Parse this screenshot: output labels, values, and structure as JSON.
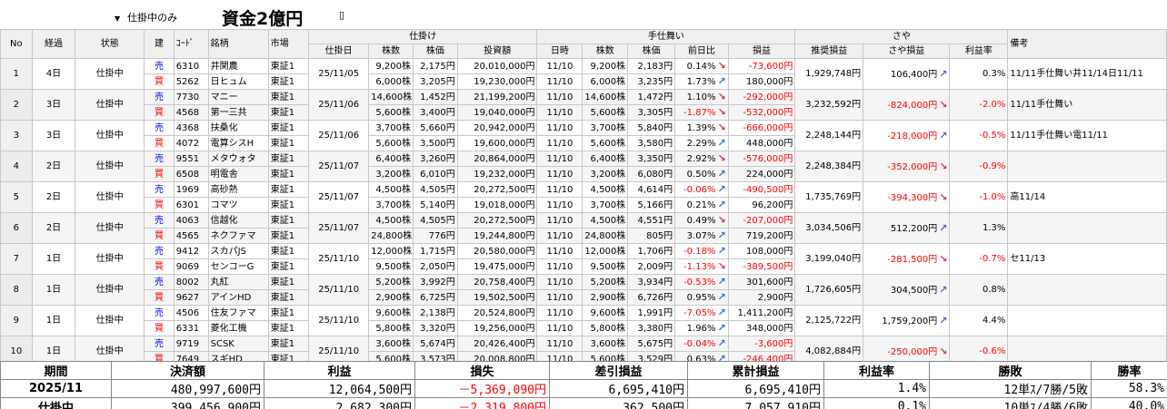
{
  "top": {
    "filter": "仕掛中のみ",
    "capital": "資金2億円",
    "tick": "▯"
  },
  "headers": {
    "no": "No",
    "elapsed": "経過",
    "state": "状態",
    "side": "建",
    "code": "ｺｰﾄﾞ",
    "name": "銘柄",
    "market": "市場",
    "open_group": "仕掛け",
    "open_date": "仕掛日",
    "shares": "株数",
    "price": "株価",
    "invest": "投資額",
    "close_group": "手仕舞い",
    "time": "日時",
    "c_shares": "株数",
    "c_price": "株価",
    "prev": "前日比",
    "pl": "損益",
    "spread_group": "さや",
    "rec_pl": "推奨損益",
    "spread_pl": "さや損益",
    "rate": "利益率",
    "note": "備考"
  },
  "rows": [
    {
      "no": "1",
      "elapsed": "4日",
      "state": "仕掛中",
      "date": "25/11/05",
      "close_date": "11/10",
      "rec": "1,929,748円",
      "spread": "106,400円",
      "spread_dir": "up",
      "rate": "0.3%",
      "rate_neg": false,
      "note": "11/11手仕舞い井11/14日11/11",
      "legs": [
        {
          "side": "売",
          "code": "6310",
          "name": "井関農",
          "market": "東証1",
          "shares": "9,200株",
          "price": "2,175円",
          "invest": "20,010,000円",
          "c_shares": "9,200株",
          "c_price": "2,183円",
          "prev": "0.14%",
          "prev_neg": false,
          "dir": "dn",
          "pl": "-73,600円",
          "pl_neg": true
        },
        {
          "side": "買",
          "code": "5262",
          "name": "日ヒュム",
          "market": "東証1",
          "shares": "6,000株",
          "price": "3,205円",
          "invest": "19,230,000円",
          "c_shares": "6,000株",
          "c_price": "3,235円",
          "prev": "1.73%",
          "prev_neg": false,
          "dir": "up",
          "pl": "180,000円",
          "pl_neg": false
        }
      ]
    },
    {
      "no": "2",
      "elapsed": "3日",
      "state": "仕掛中",
      "date": "25/11/06",
      "close_date": "11/10",
      "rec": "3,232,592円",
      "spread": "-824,000円",
      "spread_dir": "dn",
      "rate": "-2.0%",
      "rate_neg": true,
      "note": "11/11手仕舞い",
      "legs": [
        {
          "side": "売",
          "code": "7730",
          "name": "マニー",
          "market": "東証1",
          "shares": "14,600株",
          "price": "1,452円",
          "invest": "21,199,200円",
          "c_shares": "14,600株",
          "c_price": "1,472円",
          "prev": "1.10%",
          "prev_neg": false,
          "dir": "dn",
          "pl": "-292,000円",
          "pl_neg": true
        },
        {
          "side": "買",
          "code": "4568",
          "name": "第一三共",
          "market": "東証1",
          "shares": "5,600株",
          "price": "3,400円",
          "invest": "19,040,000円",
          "c_shares": "5,600株",
          "c_price": "3,305円",
          "prev": "-1.87%",
          "prev_neg": true,
          "dir": "dn",
          "pl": "-532,000円",
          "pl_neg": true
        }
      ]
    },
    {
      "no": "3",
      "elapsed": "3日",
      "state": "仕掛中",
      "date": "25/11/06",
      "close_date": "11/10",
      "rec": "2,248,144円",
      "spread": "-218,000円",
      "spread_dir": "up",
      "rate": "-0.5%",
      "rate_neg": true,
      "note": "11/11手仕舞い電11/11",
      "legs": [
        {
          "side": "売",
          "code": "4368",
          "name": "扶桑化",
          "market": "東証1",
          "shares": "3,700株",
          "price": "5,660円",
          "invest": "20,942,000円",
          "c_shares": "3,700株",
          "c_price": "5,840円",
          "prev": "1.39%",
          "prev_neg": false,
          "dir": "dn",
          "pl": "-666,000円",
          "pl_neg": true
        },
        {
          "side": "買",
          "code": "4072",
          "name": "電算シスH",
          "market": "東証1",
          "shares": "5,600株",
          "price": "3,500円",
          "invest": "19,600,000円",
          "c_shares": "5,600株",
          "c_price": "3,580円",
          "prev": "2.29%",
          "prev_neg": false,
          "dir": "up",
          "pl": "448,000円",
          "pl_neg": false
        }
      ]
    },
    {
      "no": "4",
      "elapsed": "2日",
      "state": "仕掛中",
      "date": "25/11/07",
      "close_date": "11/10",
      "rec": "2,248,384円",
      "spread": "-352,000円",
      "spread_dir": "dn",
      "rate": "-0.9%",
      "rate_neg": true,
      "note": "",
      "legs": [
        {
          "side": "売",
          "code": "9551",
          "name": "メタウォタ",
          "market": "東証1",
          "shares": "6,400株",
          "price": "3,260円",
          "invest": "20,864,000円",
          "c_shares": "6,400株",
          "c_price": "3,350円",
          "prev": "2.92%",
          "prev_neg": false,
          "dir": "dn",
          "pl": "-576,000円",
          "pl_neg": true
        },
        {
          "side": "買",
          "code": "6508",
          "name": "明電舎",
          "market": "東証1",
          "shares": "3,200株",
          "price": "6,010円",
          "invest": "19,232,000円",
          "c_shares": "3,200株",
          "c_price": "6,080円",
          "prev": "0.50%",
          "prev_neg": false,
          "dir": "up",
          "pl": "224,000円",
          "pl_neg": false
        }
      ]
    },
    {
      "no": "5",
      "elapsed": "2日",
      "state": "仕掛中",
      "date": "25/11/07",
      "close_date": "11/10",
      "rec": "1,735,769円",
      "spread": "-394,300円",
      "spread_dir": "dn",
      "rate": "-1.0%",
      "rate_neg": true,
      "note": "高11/14",
      "legs": [
        {
          "side": "売",
          "code": "1969",
          "name": "高砂熱",
          "market": "東証1",
          "shares": "4,500株",
          "price": "4,505円",
          "invest": "20,272,500円",
          "c_shares": "4,500株",
          "c_price": "4,614円",
          "prev": "-0.06%",
          "prev_neg": true,
          "dir": "up",
          "pl": "-490,500円",
          "pl_neg": true
        },
        {
          "side": "買",
          "code": "6301",
          "name": "コマツ",
          "market": "東証1",
          "shares": "3,700株",
          "price": "5,140円",
          "invest": "19,018,000円",
          "c_shares": "3,700株",
          "c_price": "5,166円",
          "prev": "0.21%",
          "prev_neg": false,
          "dir": "up",
          "pl": "96,200円",
          "pl_neg": false
        }
      ]
    },
    {
      "no": "6",
      "elapsed": "2日",
      "state": "仕掛中",
      "date": "25/11/07",
      "close_date": "11/10",
      "rec": "3,034,506円",
      "spread": "512,200円",
      "spread_dir": "up",
      "rate": "1.3%",
      "rate_neg": false,
      "note": "",
      "legs": [
        {
          "side": "売",
          "code": "4063",
          "name": "信越化",
          "market": "東証1",
          "shares": "4,500株",
          "price": "4,505円",
          "invest": "20,272,500円",
          "c_shares": "4,500株",
          "c_price": "4,551円",
          "prev": "0.49%",
          "prev_neg": false,
          "dir": "dn",
          "pl": "-207,000円",
          "pl_neg": true
        },
        {
          "side": "買",
          "code": "4565",
          "name": "ネクファマ",
          "market": "東証1",
          "shares": "24,800株",
          "price": "776円",
          "invest": "19,244,800円",
          "c_shares": "24,800株",
          "c_price": "805円",
          "prev": "3.07%",
          "prev_neg": false,
          "dir": "up",
          "pl": "719,200円",
          "pl_neg": false
        }
      ]
    },
    {
      "no": "7",
      "elapsed": "1日",
      "state": "仕掛中",
      "date": "25/11/10",
      "close_date": "11/10",
      "rec": "3,199,040円",
      "spread": "-281,500円",
      "spread_dir": "dn",
      "rate": "-0.7%",
      "rate_neg": true,
      "note": "セ11/13",
      "legs": [
        {
          "side": "売",
          "code": "9412",
          "name": "スカパJS",
          "market": "東証1",
          "shares": "12,000株",
          "price": "1,715円",
          "invest": "20,580,000円",
          "c_shares": "12,000株",
          "c_price": "1,706円",
          "prev": "-0.18%",
          "prev_neg": true,
          "dir": "up",
          "pl": "108,000円",
          "pl_neg": false
        },
        {
          "side": "買",
          "code": "9069",
          "name": "センコーG",
          "market": "東証1",
          "shares": "9,500株",
          "price": "2,050円",
          "invest": "19,475,000円",
          "c_shares": "9,500株",
          "c_price": "2,009円",
          "prev": "-1.13%",
          "prev_neg": true,
          "dir": "dn",
          "pl": "-389,500円",
          "pl_neg": true
        }
      ]
    },
    {
      "no": "8",
      "elapsed": "1日",
      "state": "仕掛中",
      "date": "25/11/10",
      "close_date": "11/10",
      "rec": "1,726,605円",
      "spread": "304,500円",
      "spread_dir": "up",
      "rate": "0.8%",
      "rate_neg": false,
      "note": "",
      "legs": [
        {
          "side": "売",
          "code": "8002",
          "name": "丸紅",
          "market": "東証1",
          "shares": "5,200株",
          "price": "3,992円",
          "invest": "20,758,400円",
          "c_shares": "5,200株",
          "c_price": "3,934円",
          "prev": "-0.53%",
          "prev_neg": true,
          "dir": "up",
          "pl": "301,600円",
          "pl_neg": false
        },
        {
          "side": "買",
          "code": "9627",
          "name": "アインHD",
          "market": "東証1",
          "shares": "2,900株",
          "price": "6,725円",
          "invest": "19,502,500円",
          "c_shares": "2,900株",
          "c_price": "6,726円",
          "prev": "0.95%",
          "prev_neg": false,
          "dir": "up",
          "pl": "2,900円",
          "pl_neg": false
        }
      ]
    },
    {
      "no": "9",
      "elapsed": "1日",
      "state": "仕掛中",
      "date": "25/11/10",
      "close_date": "11/10",
      "rec": "2,125,722円",
      "spread": "1,759,200円",
      "spread_dir": "up",
      "rate": "4.4%",
      "rate_neg": false,
      "note": "",
      "legs": [
        {
          "side": "売",
          "code": "4506",
          "name": "住友ファマ",
          "market": "東証1",
          "shares": "9,600株",
          "price": "2,138円",
          "invest": "20,524,800円",
          "c_shares": "9,600株",
          "c_price": "1,991円",
          "prev": "-7.05%",
          "prev_neg": true,
          "dir": "up",
          "pl": "1,411,200円",
          "pl_neg": false
        },
        {
          "side": "買",
          "code": "6331",
          "name": "菱化工機",
          "market": "東証1",
          "shares": "5,800株",
          "price": "3,320円",
          "invest": "19,256,000円",
          "c_shares": "5,800株",
          "c_price": "3,380円",
          "prev": "1.96%",
          "prev_neg": false,
          "dir": "up",
          "pl": "348,000円",
          "pl_neg": false
        }
      ]
    },
    {
      "no": "10",
      "elapsed": "1日",
      "state": "仕掛中",
      "date": "25/11/10",
      "close_date": "11/10",
      "rec": "4,082,884円",
      "spread": "-250,000円",
      "spread_dir": "dn",
      "rate": "-0.6%",
      "rate_neg": true,
      "note": "",
      "legs": [
        {
          "side": "売",
          "code": "9719",
          "name": "SCSK",
          "market": "東証1",
          "shares": "3,600株",
          "price": "5,674円",
          "invest": "20,426,400円",
          "c_shares": "3,600株",
          "c_price": "5,675円",
          "prev": "-0.04%",
          "prev_neg": true,
          "dir": "up",
          "pl": "-3,600円",
          "pl_neg": true
        },
        {
          "side": "買",
          "code": "7649",
          "name": "スギHD",
          "market": "東証1",
          "shares": "5,600株",
          "price": "3,573円",
          "invest": "20,008,800円",
          "c_shares": "5,600株",
          "c_price": "3,529円",
          "prev": "0.63%",
          "prev_neg": false,
          "dir": "up",
          "pl": "-246,400円",
          "pl_neg": true
        }
      ]
    }
  ],
  "totals": {
    "invest": "399,456,900円",
    "pl": "362,500円",
    "spread": "362,500円",
    "rate": "0.1%"
  },
  "summary": {
    "headers": [
      "期間",
      "決済額",
      "利益",
      "損失",
      "差引損益",
      "累計損益",
      "利益率",
      "勝敗",
      "勝率"
    ],
    "rows": [
      {
        "label": "2025/11",
        "settle": "480,997,600円",
        "profit": "12,064,500円",
        "loss": "－5,369,090円",
        "net": "6,695,410円",
        "cum": "6,695,410円",
        "rate": "1.4%",
        "wl": "12単ｽ/7勝/5敗",
        "win": "58.3%"
      },
      {
        "label": "仕掛中",
        "settle": "399,456,900円",
        "profit": "2,682,300円",
        "loss": "－2,319,800円",
        "net": "362,500円",
        "cum": "7,057,910円",
        "rate": "0.1%",
        "wl": "10単ｽ/4勝/6敗",
        "win": "40.0%"
      }
    ]
  }
}
